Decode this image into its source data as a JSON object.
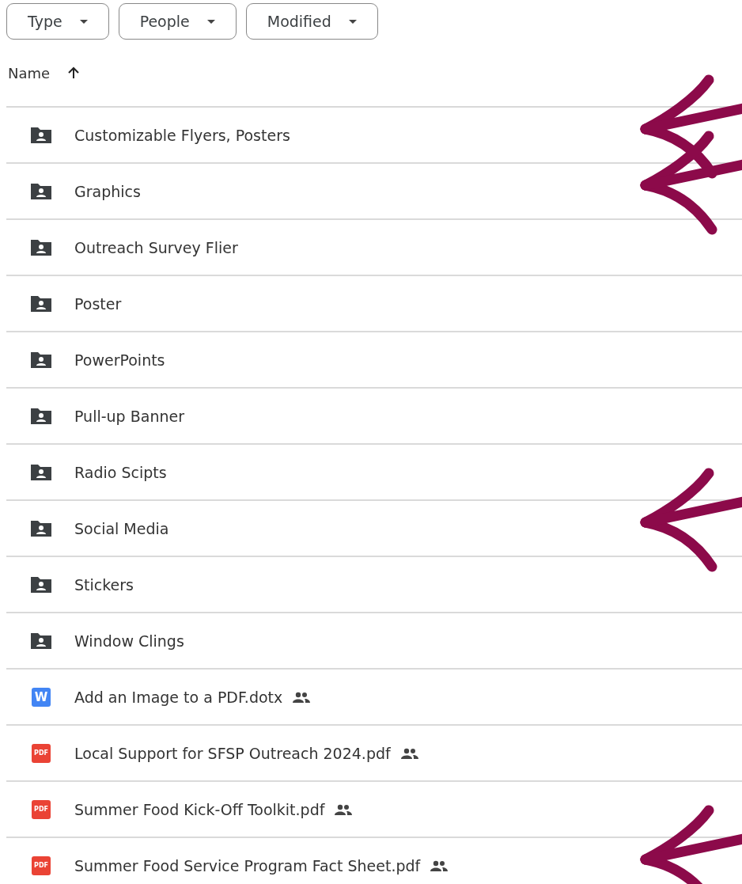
{
  "filters": [
    {
      "label": "Type"
    },
    {
      "label": "People"
    },
    {
      "label": "Modified"
    }
  ],
  "header": {
    "label": "Name",
    "sort_ascending": true
  },
  "files": [
    {
      "kind": "folder",
      "name": "Customizable Flyers, Posters",
      "shared": false,
      "arrow": true
    },
    {
      "kind": "folder",
      "name": "Graphics",
      "shared": false,
      "arrow": true
    },
    {
      "kind": "folder",
      "name": "Outreach Survey Flier",
      "shared": false,
      "arrow": false
    },
    {
      "kind": "folder",
      "name": "Poster",
      "shared": false,
      "arrow": false
    },
    {
      "kind": "folder",
      "name": "PowerPoints",
      "shared": false,
      "arrow": false
    },
    {
      "kind": "folder",
      "name": "Pull-up Banner",
      "shared": false,
      "arrow": false
    },
    {
      "kind": "folder",
      "name": "Radio Scipts",
      "shared": false,
      "arrow": false
    },
    {
      "kind": "folder",
      "name": "Social Media",
      "shared": false,
      "arrow": true
    },
    {
      "kind": "folder",
      "name": "Stickers",
      "shared": false,
      "arrow": false
    },
    {
      "kind": "folder",
      "name": "Window Clings",
      "shared": false,
      "arrow": false
    },
    {
      "kind": "doc",
      "icon_text": "W",
      "name": "Add an Image to a PDF.dotx",
      "shared": true,
      "arrow": false
    },
    {
      "kind": "pdf",
      "icon_text": "PDF",
      "name": "Local Support for SFSP Outreach 2024.pdf",
      "shared": true,
      "arrow": false
    },
    {
      "kind": "pdf",
      "icon_text": "PDF",
      "name": "Summer Food Kick-Off Toolkit.pdf",
      "shared": true,
      "arrow": false
    },
    {
      "kind": "pdf",
      "icon_text": "PDF",
      "name": "Summer Food Service Program Fact Sheet.pdf",
      "shared": true,
      "arrow": true
    }
  ]
}
